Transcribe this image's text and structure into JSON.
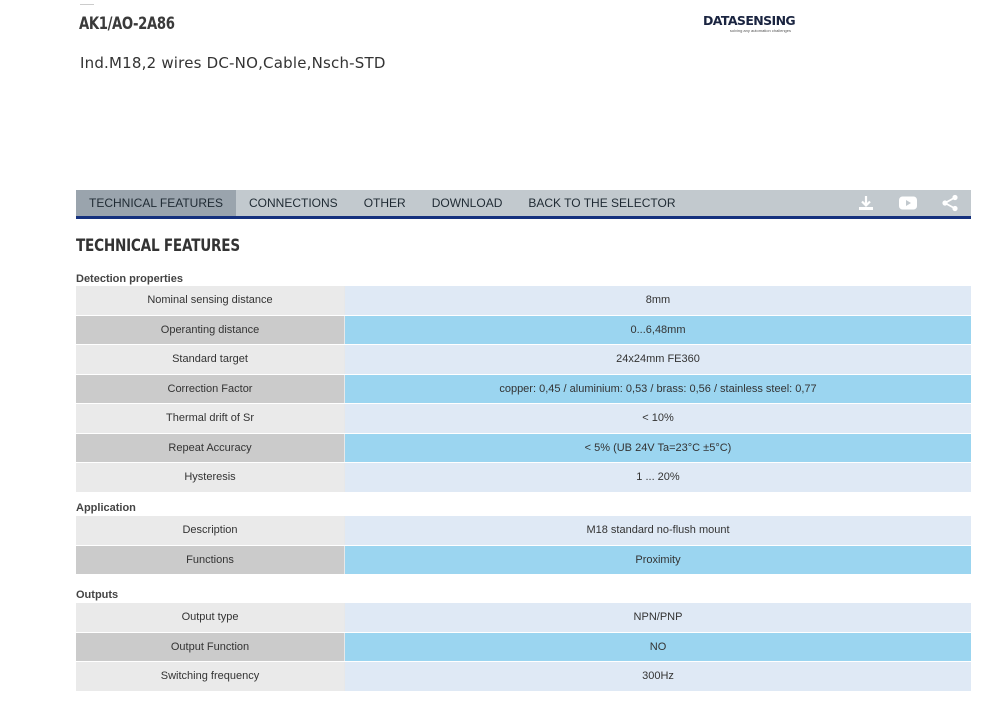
{
  "product": {
    "code": "AK1/AO-2A86",
    "description": "Ind.M18,2 wires DC-NO,Cable,Nsch-STD"
  },
  "logo": {
    "name": "DATASENSING",
    "tagline": "solving any automation challenges"
  },
  "tabs": [
    {
      "label": "TECHNICAL FEATURES",
      "active": true
    },
    {
      "label": "CONNECTIONS",
      "active": false
    },
    {
      "label": "OTHER",
      "active": false
    },
    {
      "label": "DOWNLOAD",
      "active": false
    },
    {
      "label": "BACK TO THE SELECTOR",
      "active": false
    }
  ],
  "tab_icons": [
    "download-icon",
    "youtube-icon",
    "share-icon"
  ],
  "section_title": "TECHNICAL FEATURES",
  "groups": [
    {
      "label": "Detection properties",
      "rows": [
        {
          "key": "Nominal sensing distance",
          "value": "8mm"
        },
        {
          "key": "Operanting distance",
          "value": "0...6,48mm"
        },
        {
          "key": "Standard target",
          "value": "24x24mm FE360"
        },
        {
          "key": "Correction Factor",
          "value": "copper: 0,45 / aluminium: 0,53 / brass: 0,56 / stainless steel: 0,77"
        },
        {
          "key": "Thermal drift of Sr",
          "value": "< 10%"
        },
        {
          "key": "Repeat Accuracy",
          "value": "< 5% (UB 24V Ta=23°C ±5°C)"
        },
        {
          "key": "Hysteresis",
          "value": "1 ... 20%"
        }
      ]
    },
    {
      "label": "Application",
      "rows": [
        {
          "key": "Description",
          "value": "M18 standard no-flush mount"
        },
        {
          "key": "Functions",
          "value": "Proximity"
        }
      ]
    },
    {
      "label": "Outputs",
      "rows": [
        {
          "key": "Output type",
          "value": "NPN/PNP"
        },
        {
          "key": "Output Function",
          "value": "NO"
        },
        {
          "key": "Switching frequency",
          "value": "300Hz"
        }
      ]
    }
  ],
  "colors": {
    "accent": "#15317e",
    "tabbar": "#c2c9ce",
    "tab_active": "#9aa4ad",
    "row_value_light": "#dfe9f5",
    "row_value_dark": "#9bd5f0"
  }
}
